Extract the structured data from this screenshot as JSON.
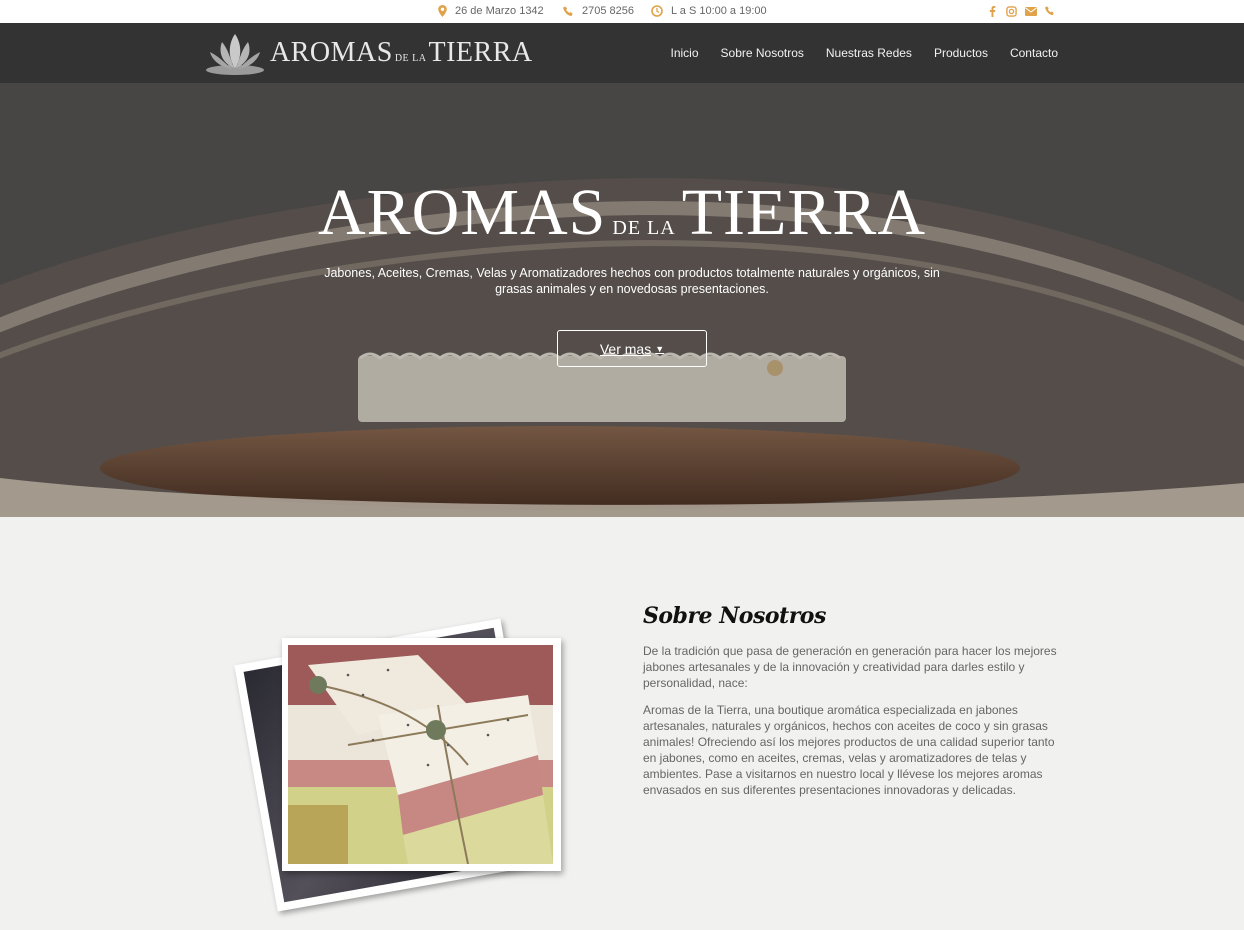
{
  "topbar": {
    "address": "26 de Marzo 1342",
    "phone": "2705 8256",
    "hours": "L a S 10:00 a 19:00",
    "icons": [
      "map-marker-icon",
      "phone-icon",
      "clock-icon"
    ],
    "social_icons": [
      "facebook-icon",
      "instagram-icon",
      "envelope-icon",
      "phone-icon"
    ],
    "accent_color": "#e0a24a"
  },
  "brand": {
    "name_part1": "AROMAS",
    "name_mid": "DE LA",
    "name_part2": "TIERRA",
    "logo_icon": "lotus-icon"
  },
  "nav": {
    "items": [
      "Inicio",
      "Sobre Nosotros",
      "Nuestras Redes",
      "Productos",
      "Contacto"
    ]
  },
  "hero": {
    "title_part1": "AROMAS",
    "title_mid": "DE LA",
    "title_part2": "TIERRA",
    "subtitle": "Jabones, Aceites, Cremas, Velas y Aromatizadores hechos con productos totalmente naturales y orgánicos, sin grasas animales y en novedosas presentaciones.",
    "button_label": "Ver mas"
  },
  "about": {
    "title": "Sobre Nosotros",
    "paragraph1": "De la tradición que pasa de generación en generación para hacer los mejores jabones artesanales y de la innovación y creatividad para darles estilo y personalidad, nace:",
    "paragraph2": "Aromas de la Tierra, una boutique aromática especializada en jabones artesanales, naturales y orgánicos, hechos con aceites de coco y sin grasas animales! Ofreciendo así los mejores productos de una calidad superior tanto en jabones, como en aceites, cremas, velas y aromatizadores de telas y ambientes. Pase a visitarnos en nuestro local y llévese los mejores aromas envasados en sus diferentes presentaciones innovadoras y delicadas."
  }
}
